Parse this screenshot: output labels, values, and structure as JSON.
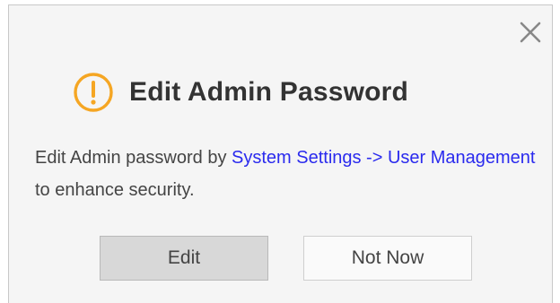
{
  "dialog": {
    "close_label": "×",
    "title": "Edit Admin Password",
    "icon": "warning-icon",
    "accent_color": "#f5a623",
    "message": {
      "before": "Edit Admin password by ",
      "link": "System Settings -> User Management",
      "after": " to enhance security."
    },
    "buttons": {
      "edit": "Edit",
      "not_now": "Not Now"
    }
  }
}
